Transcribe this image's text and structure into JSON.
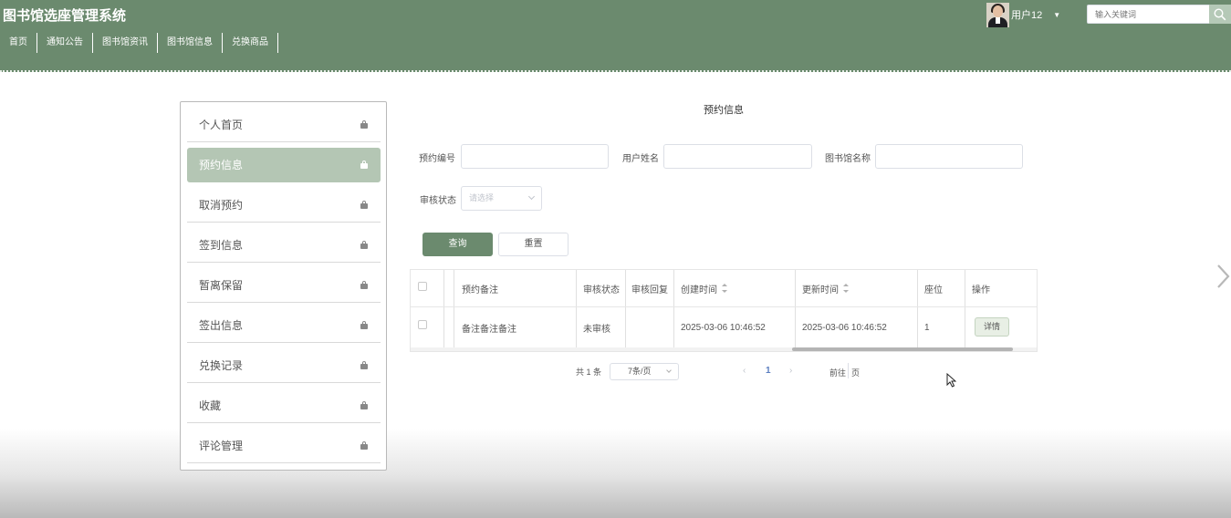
{
  "header": {
    "site_title": "图书馆选座管理系统",
    "user_name": "用户12",
    "search_placeholder": "输入关键词"
  },
  "nav": {
    "items": [
      "首页",
      "通知公告",
      "图书馆资讯",
      "图书馆信息",
      "兑换商品"
    ]
  },
  "sidebar": {
    "items": [
      {
        "label": "个人首页",
        "active": false
      },
      {
        "label": "预约信息",
        "active": true
      },
      {
        "label": "取消预约",
        "active": false
      },
      {
        "label": "签到信息",
        "active": false
      },
      {
        "label": "暂离保留",
        "active": false
      },
      {
        "label": "签出信息",
        "active": false
      },
      {
        "label": "兑换记录",
        "active": false
      },
      {
        "label": "收藏",
        "active": false
      },
      {
        "label": "评论管理",
        "active": false
      }
    ]
  },
  "main": {
    "title": "预约信息",
    "filters": {
      "booking_no_label": "预约编号",
      "booking_no_value": "",
      "user_name_label": "用户姓名",
      "user_name_value": "",
      "library_name_label": "图书馆名称",
      "library_name_value": "",
      "review_status_label": "审核状态",
      "review_status_placeholder": "请选择"
    },
    "buttons": {
      "query": "查询",
      "reset": "重置"
    },
    "table": {
      "headers": [
        "预约备注",
        "审核状态",
        "审核回复",
        "创建时间",
        "更新时间",
        "座位",
        "操作"
      ],
      "rows": [
        {
          "remark": "备注备注备注",
          "review_status": "未审核",
          "review_reply": "",
          "created_at": "2025-03-06 10:46:52",
          "updated_at": "2025-03-06 10:46:52",
          "seat": "1",
          "action": "详情"
        }
      ]
    },
    "pagination": {
      "total": "共 1 条",
      "page_size": "7条/页",
      "current_page": "1",
      "goto_label": "前往",
      "page_unit": "页"
    }
  },
  "colors": {
    "header_bg": "#6b8a6e",
    "active_menu_bg": "#b4c6b4",
    "query_button_bg": "#6b8a6e",
    "current_page": "#5b7ec0"
  }
}
